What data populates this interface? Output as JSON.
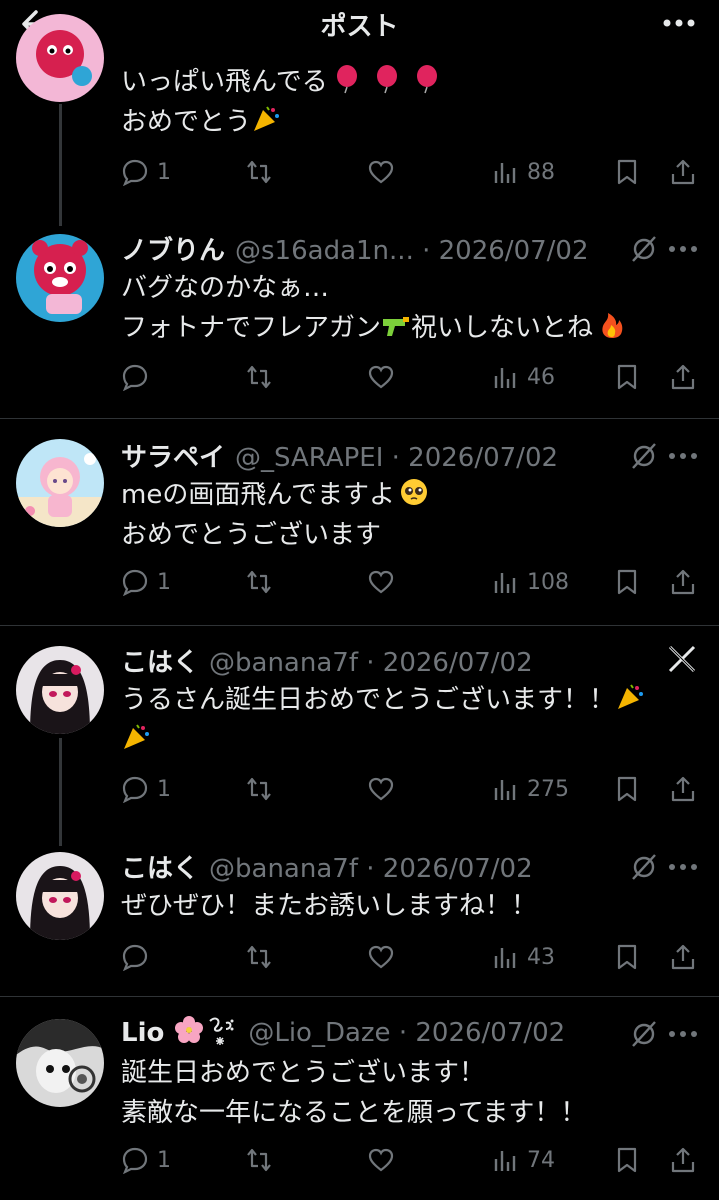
{
  "header": {
    "title": "ポスト"
  },
  "tweets": [
    {
      "text_lines": [
        "いっぱい飛んでる",
        "おめでとう"
      ],
      "stats": {
        "replies": "1",
        "views": "88"
      }
    },
    {
      "name": "ノブりん",
      "handle": "@s16ada1n...",
      "date": "· 2026/07/02",
      "text_lines": [
        "バグなのかなぁ…",
        "フォトナでフレアガン",
        "祝いしないとね"
      ],
      "stats": {
        "views": "46"
      }
    },
    {
      "name": "サラペイ",
      "handle": "@_SARAPEI",
      "date": "· 2026/07/02",
      "text_lines": [
        "meの画面飛んでますよ",
        "おめでとうございます"
      ],
      "stats": {
        "replies": "1",
        "views": "108"
      }
    },
    {
      "name": "こはく",
      "handle": "@banana7f",
      "date": "· 2026/07/02",
      "text_lines": [
        "うるさん誕生日おめでとうございます！！"
      ],
      "stats": {
        "replies": "1",
        "views": "275"
      }
    },
    {
      "name": "こはく",
      "handle": "@banana7f",
      "date": "· 2026/07/02",
      "text_lines": [
        "ぜひぜひ！またお誘いしますね！！"
      ],
      "stats": {
        "views": "43"
      }
    },
    {
      "name": "Lio",
      "handle": "@Lio_Daze",
      "date": "· 2026/07/02",
      "text_lines": [
        "誕生日おめでとうございます！",
        "素敵な一年になることを願ってます！！"
      ],
      "stats": {
        "replies": "1",
        "views": "74"
      }
    }
  ]
}
